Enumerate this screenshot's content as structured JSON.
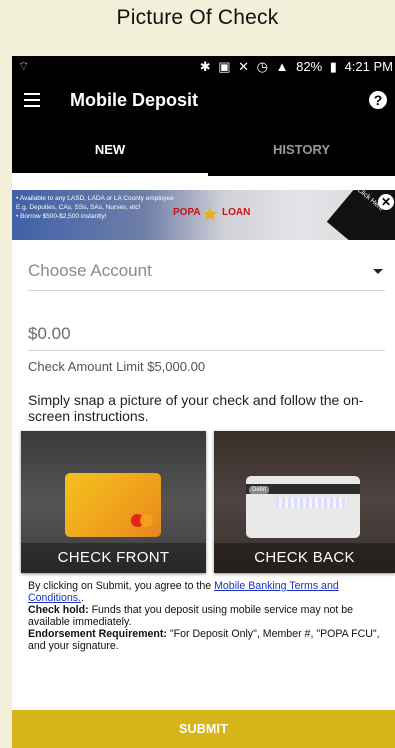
{
  "caption": "Picture Of Check",
  "status_bar": {
    "battery": "82%",
    "time": "4:21 PM",
    "icons": [
      "wifi-icon",
      "bluetooth-icon",
      "nfc-icon",
      "mute-icon",
      "alarm-icon",
      "lte-icon",
      "signal-icon",
      "battery-icon"
    ]
  },
  "app_bar": {
    "title": "Mobile Deposit",
    "help": "?"
  },
  "tabs": [
    {
      "label": "NEW",
      "selected": true
    },
    {
      "label": "HISTORY",
      "selected": false
    }
  ],
  "banner": {
    "line1": "• Available to any LASD, LADA or LA County employee",
    "line2": "E.g. Deputies, CAs, SSs, SAs, Nurses, etc!",
    "line3": "• Borrow $500-$2,500 instantly!",
    "brand_a": "POPA",
    "brand_b": "LOAN",
    "corner_text": "Click Here",
    "close": "✕"
  },
  "form": {
    "account_placeholder": "Choose Account",
    "amount_value": "$0.00",
    "amount_limit": "Check Amount Limit  $5,000.00",
    "instructions": "Simply snap a picture of your check and follow the on-screen instructions."
  },
  "photos": {
    "front_label": "CHECK FRONT",
    "back_label": "CHECK BACK",
    "back_card_text": "Debit"
  },
  "terms": {
    "intro": "By clicking on Submit, you agree to the ",
    "link": "Mobile Banking Terms and Conditions.",
    "after_link": ".",
    "hold_label": "Check hold:",
    "hold_text": " Funds that you deposit using mobile service may not be available immediately.",
    "endorse_label": "Endorsement Requirement:",
    "endorse_text": " \"For Deposit Only\", Member #, \"POPA FCU\", and your signature."
  },
  "submit_label": "SUBMIT",
  "colors": {
    "accent": "#d7b41a",
    "header": "#000000",
    "link": "#1a33c4",
    "page_bg": "#f2f0d8"
  }
}
